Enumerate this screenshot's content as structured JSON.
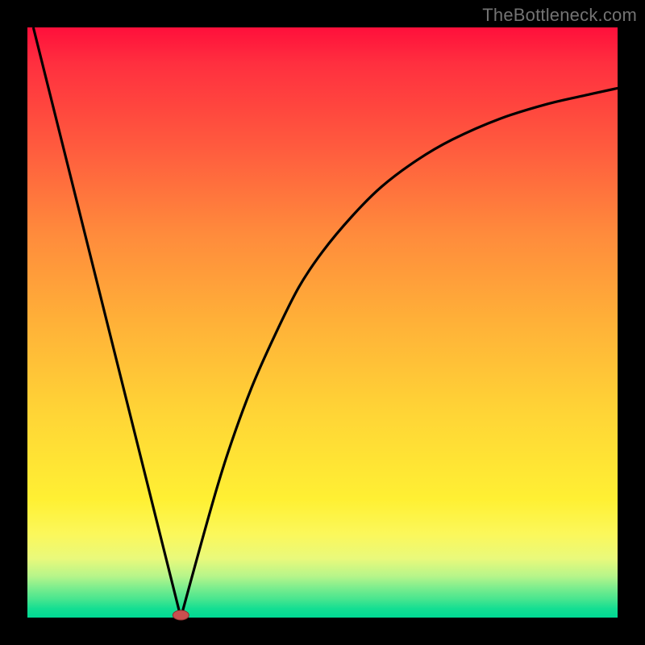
{
  "watermark": "TheBottleneck.com",
  "chart_data": {
    "type": "line",
    "title": "",
    "xlabel": "",
    "ylabel": "",
    "xlim": [
      0,
      100
    ],
    "ylim": [
      0,
      100
    ],
    "grid": false,
    "series": [
      {
        "name": "left-descent",
        "x": [
          1,
          26
        ],
        "y": [
          100,
          0
        ]
      },
      {
        "name": "right-ascent",
        "x": [
          26,
          30,
          34,
          38,
          42,
          46,
          50,
          55,
          60,
          66,
          72,
          80,
          88,
          95,
          100
        ],
        "y": [
          0,
          15,
          28,
          39,
          48,
          56,
          62,
          68,
          73,
          77.5,
          81,
          84.5,
          87,
          88.6,
          89.7
        ]
      }
    ],
    "marker": {
      "x": 26,
      "y": 0,
      "color": "#c94f4f"
    },
    "background_gradient": {
      "orientation": "vertical",
      "stops": [
        {
          "pos": 0.0,
          "color": "#ff0f3b"
        },
        {
          "pos": 0.5,
          "color": "#ffb138"
        },
        {
          "pos": 0.8,
          "color": "#fff033"
        },
        {
          "pos": 1.0,
          "color": "#00d993"
        }
      ]
    }
  }
}
